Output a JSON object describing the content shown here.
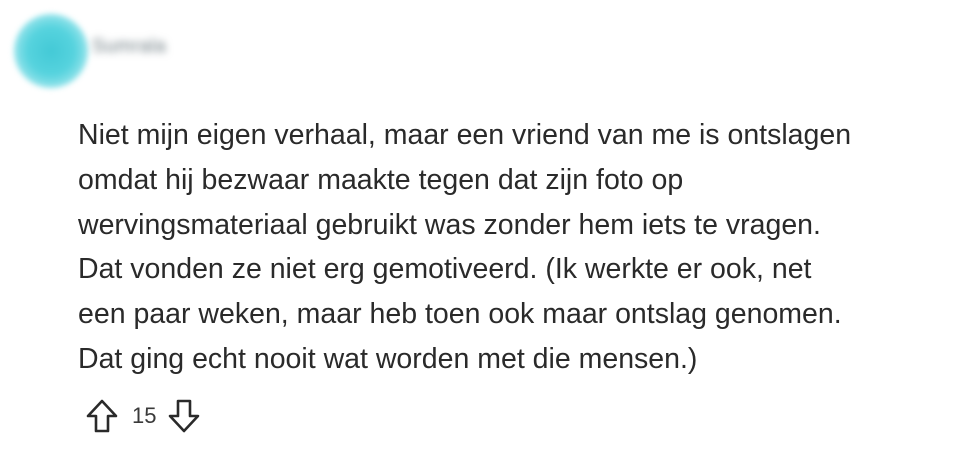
{
  "comment": {
    "username": "Sumrala",
    "avatar_color": "#4fd0dc",
    "body": "Niet mijn eigen verhaal, maar een vriend van me is ontslagen\nomdat hij bezwaar maakte tegen dat zijn foto op\nwervingsmateriaal gebruikt was zonder hem iets te vragen.\nDat vonden ze niet erg gemotiveerd. (Ik werkte er ook, net\neen paar weken, maar heb toen ook maar ontslag genomen.\nDat ging echt nooit wat worden met die mensen.)",
    "votes": "15",
    "upvote_icon": "arrow-up-outline-icon",
    "downvote_icon": "arrow-down-outline-icon"
  }
}
